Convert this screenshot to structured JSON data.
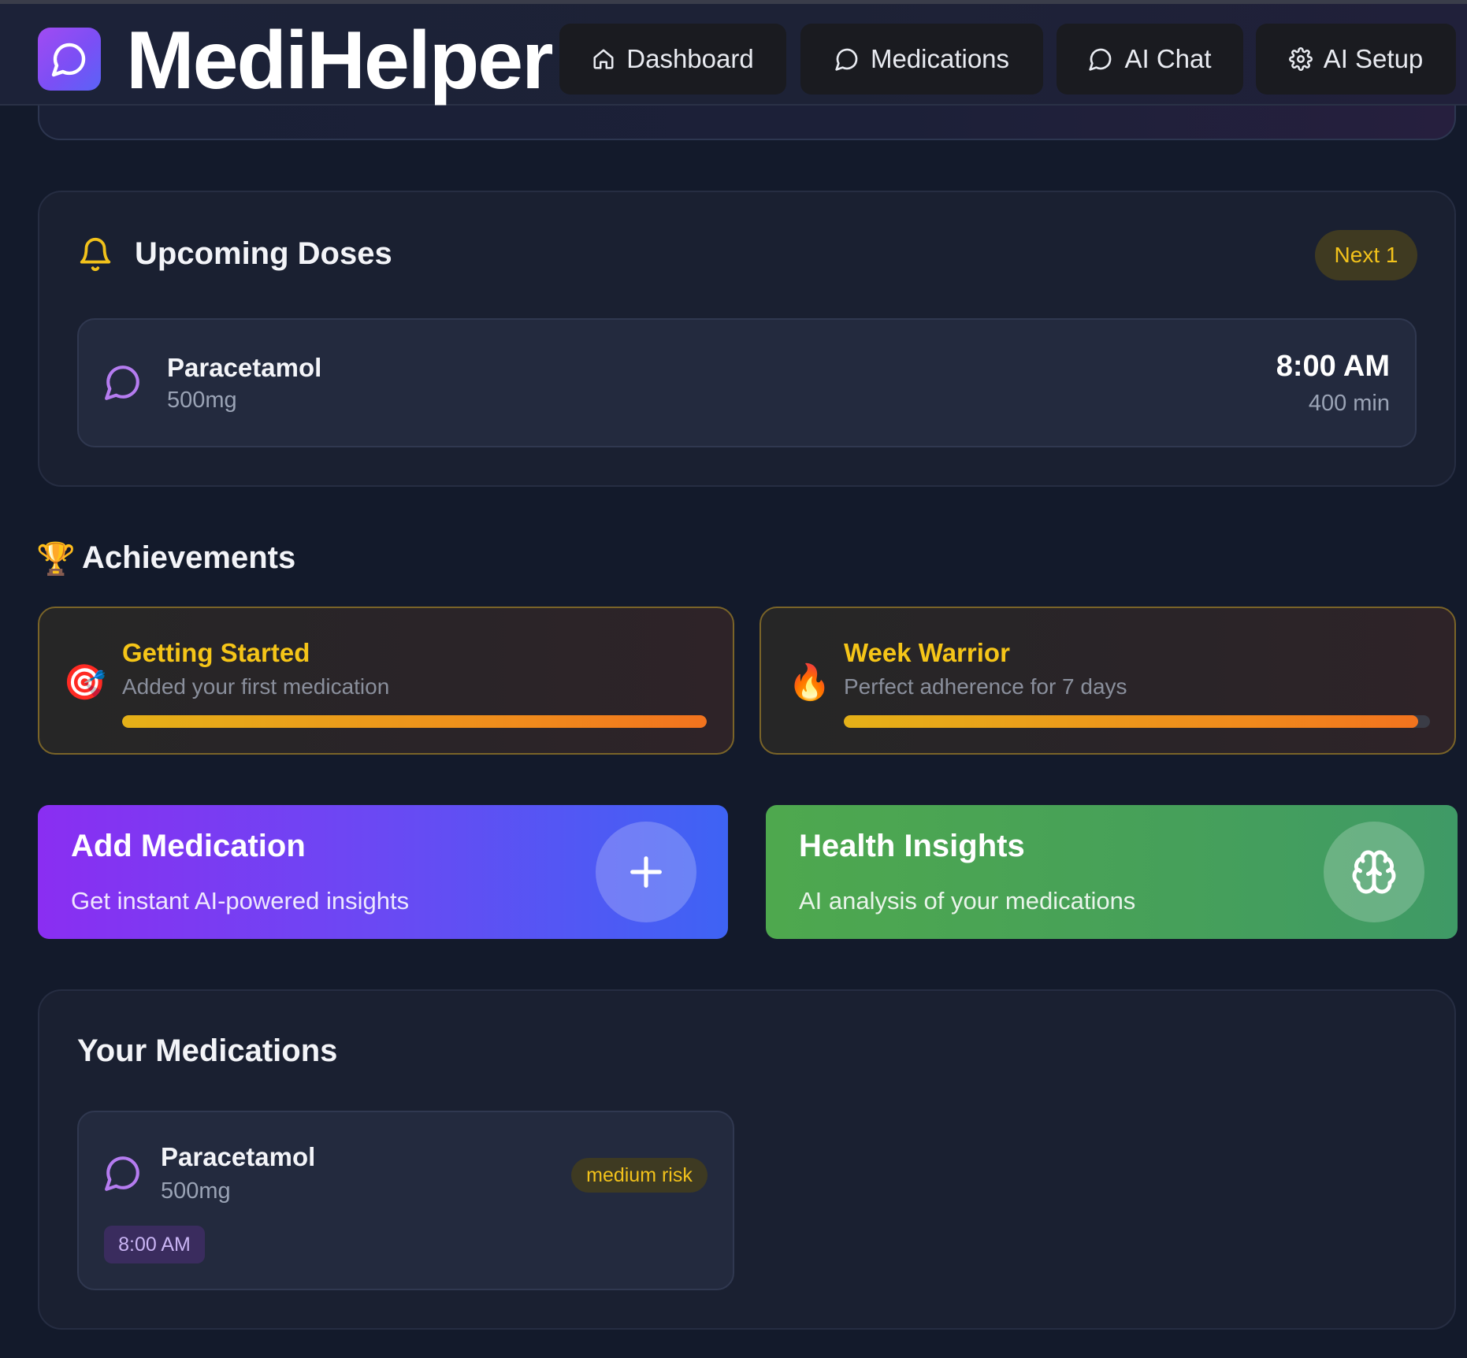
{
  "app": {
    "title": "MediHelper",
    "brand_icon": "chat-bubble-icon"
  },
  "nav": {
    "items": [
      {
        "label": "Dashboard",
        "icon": "home-icon"
      },
      {
        "label": "Medications",
        "icon": "chat-bubble-icon"
      },
      {
        "label": "AI Chat",
        "icon": "chat-bubble-icon"
      },
      {
        "label": "AI Setup",
        "icon": "gear-icon"
      }
    ]
  },
  "upcoming": {
    "title": "Upcoming Doses",
    "icon": "bell-icon",
    "badge": "Next 1",
    "doses": [
      {
        "name": "Paracetamol",
        "amount": "500mg",
        "time": "8:00 AM",
        "eta": "400 min",
        "icon": "chat-bubble-icon"
      }
    ]
  },
  "achievements": {
    "title": "Achievements",
    "icon": "trophy-icon",
    "items": [
      {
        "emoji": "🎯",
        "title": "Getting Started",
        "description": "Added your first medication",
        "progress": 1.0
      },
      {
        "emoji": "🔥",
        "title": "Week Warrior",
        "description": "Perfect adherence for 7 days",
        "progress": 0.98
      }
    ]
  },
  "actions": {
    "add": {
      "title": "Add Medication",
      "description": "Get instant AI-powered insights",
      "icon": "plus-icon"
    },
    "health": {
      "title": "Health Insights",
      "description": "AI analysis of your medications",
      "icon": "brain-icon"
    }
  },
  "medications": {
    "title": "Your Medications",
    "items": [
      {
        "name": "Paracetamol",
        "amount": "500mg",
        "risk": "medium risk",
        "time": "8:00 AM",
        "icon": "chat-bubble-icon"
      }
    ]
  },
  "colors": {
    "background": "#131a2b",
    "accent_purple": "#8a2ef2",
    "accent_yellow": "#f5c518",
    "accent_green": "#4ea84e"
  }
}
